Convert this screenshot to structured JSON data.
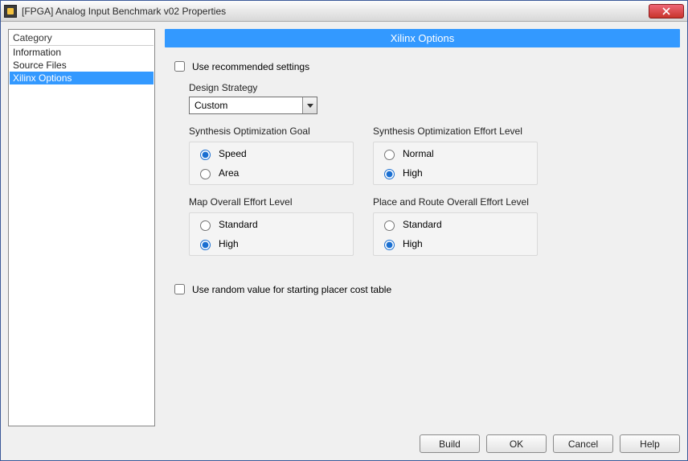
{
  "window": {
    "title": "[FPGA] Analog Input Benchmark v02 Properties"
  },
  "sidebar": {
    "header": "Category",
    "items": [
      {
        "label": "Information",
        "selected": false
      },
      {
        "label": "Source Files",
        "selected": false
      },
      {
        "label": "Xilinx Options",
        "selected": true
      }
    ]
  },
  "banner": "Xilinx Options",
  "form": {
    "use_recommended": {
      "label": "Use recommended settings",
      "checked": false
    },
    "design_strategy": {
      "label": "Design Strategy",
      "value": "Custom"
    },
    "synthesis_goal": {
      "label": "Synthesis Optimization Goal",
      "options": [
        "Speed",
        "Area"
      ],
      "selected": "Speed"
    },
    "synthesis_effort": {
      "label": "Synthesis Optimization Effort Level",
      "options": [
        "Normal",
        "High"
      ],
      "selected": "High"
    },
    "map_effort": {
      "label": "Map Overall Effort Level",
      "options": [
        "Standard",
        "High"
      ],
      "selected": "High"
    },
    "par_effort": {
      "label": "Place and Route Overall Effort Level",
      "options": [
        "Standard",
        "High"
      ],
      "selected": "High"
    },
    "use_random": {
      "label": "Use random value for starting placer cost table",
      "checked": false
    }
  },
  "buttons": {
    "build": "Build",
    "ok": "OK",
    "cancel": "Cancel",
    "help": "Help"
  }
}
